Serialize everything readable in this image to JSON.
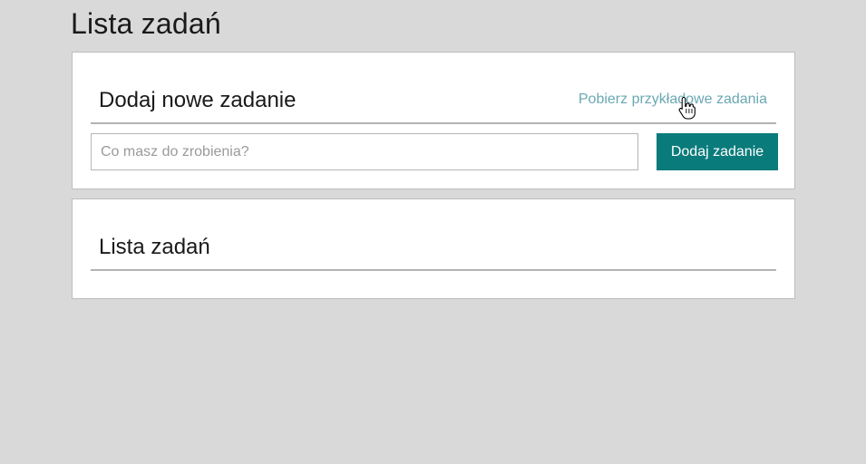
{
  "page": {
    "title": "Lista zadań"
  },
  "add_panel": {
    "heading": "Dodaj nowe zadanie",
    "sample_link": "Pobierz przykładowe zadania",
    "input_placeholder": "Co masz do zrobienia?",
    "input_value": "",
    "add_button": "Dodaj zadanie"
  },
  "list_panel": {
    "heading": "Lista zadań",
    "tasks": []
  },
  "colors": {
    "background": "#d9d9d9",
    "panel": "#ffffff",
    "accent": "#0a7b7b",
    "link": "#6aa8b3"
  },
  "icons": {
    "cursor": "hand-pointer-icon"
  }
}
